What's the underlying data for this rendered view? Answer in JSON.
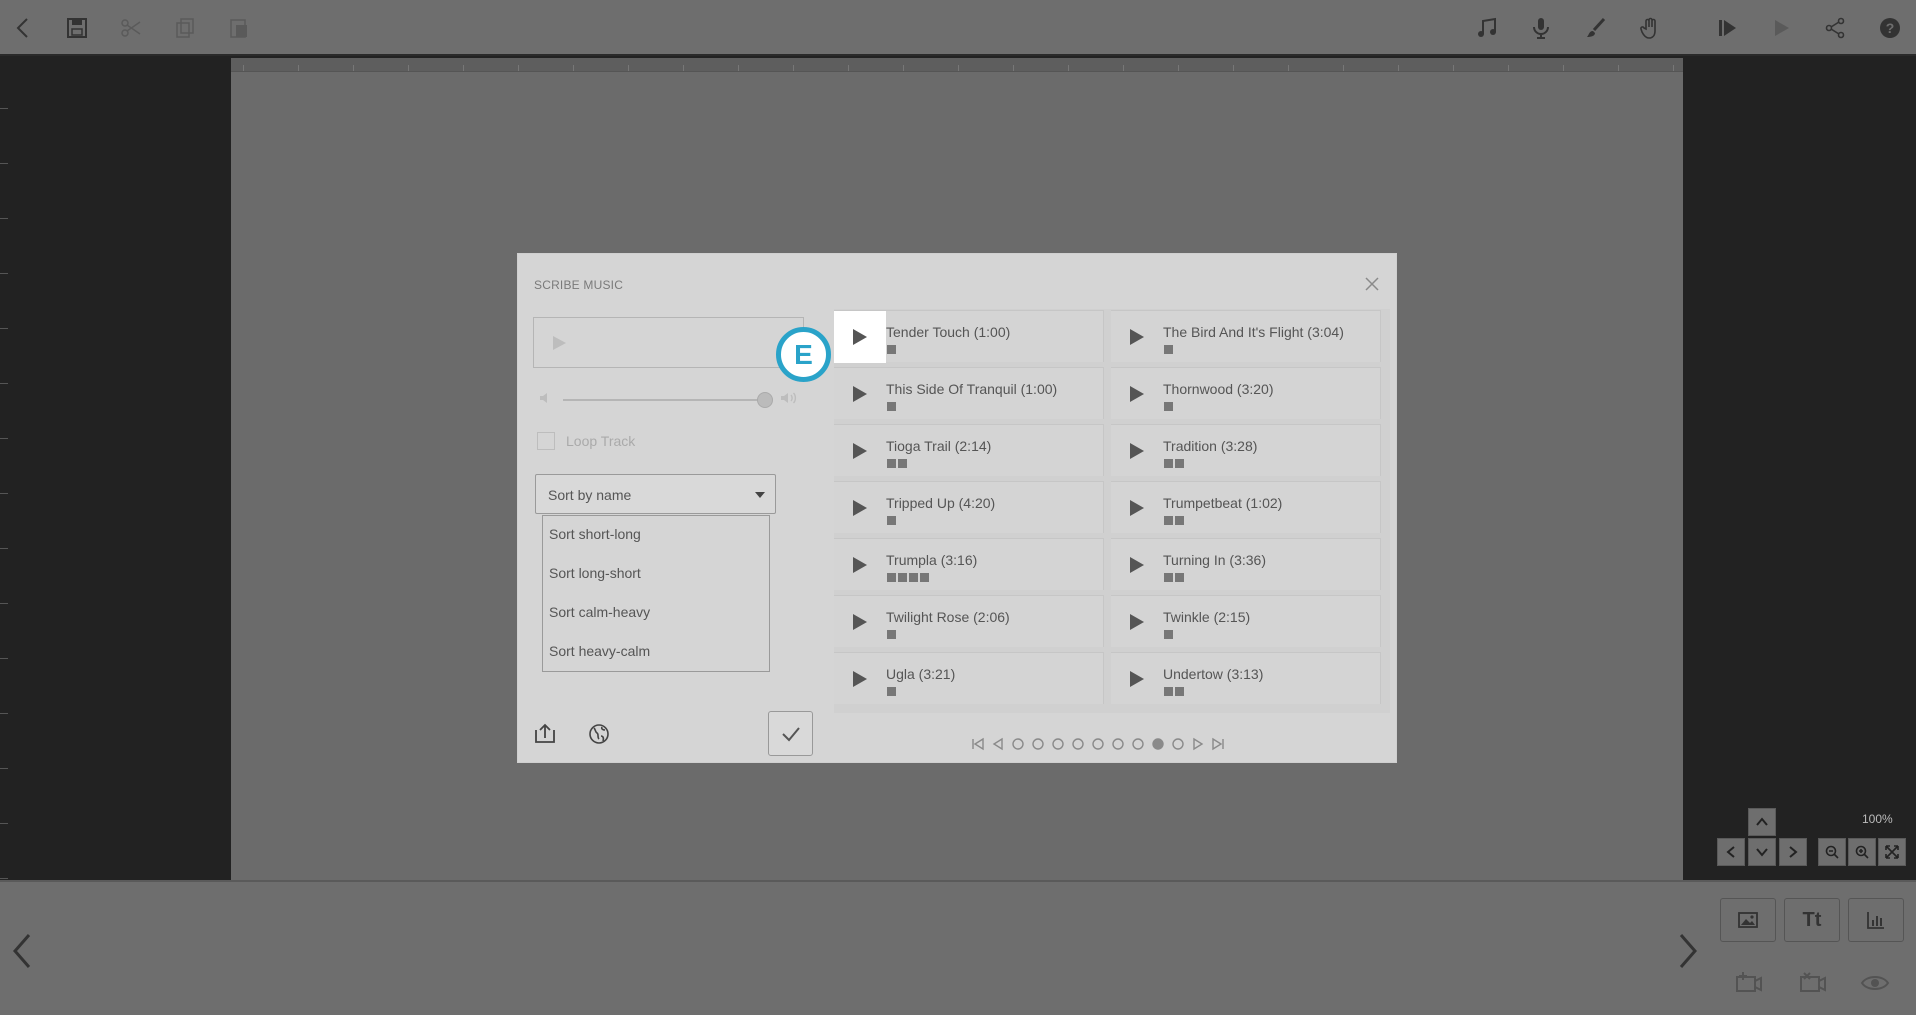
{
  "zoom_label": "100%",
  "toolbar": {
    "left_icons": [
      "back-icon",
      "save-icon",
      "cut-icon",
      "copy-icon",
      "paste-icon"
    ],
    "right_icons": [
      "music-icon",
      "microphone-icon",
      "brush-icon",
      "hand-icon",
      "play-from-icon",
      "play-icon",
      "share-icon",
      "help-icon"
    ]
  },
  "bottom": {
    "text_button_label": "Tt"
  },
  "dialog": {
    "title": "SCRIBE MUSIC",
    "loop_label": "Loop Track",
    "sort": {
      "selected": "Sort by name",
      "options": [
        "Sort short-long",
        "Sort long-short",
        "Sort calm-heavy",
        "Sort heavy-calm"
      ]
    },
    "tracks": [
      {
        "name": "Tender Touch (1:00)",
        "intensity": 1
      },
      {
        "name": "The Bird And It's Flight (3:04)",
        "intensity": 1
      },
      {
        "name": "This Side Of Tranquil (1:00)",
        "intensity": 1
      },
      {
        "name": "Thornwood (3:20)",
        "intensity": 1
      },
      {
        "name": "Tioga Trail (2:14)",
        "intensity": 2
      },
      {
        "name": "Tradition (3:28)",
        "intensity": 2
      },
      {
        "name": "Tripped Up (4:20)",
        "intensity": 1
      },
      {
        "name": "Trumpetbeat (1:02)",
        "intensity": 2
      },
      {
        "name": "Trumpla (3:16)",
        "intensity": 4
      },
      {
        "name": "Turning In (3:36)",
        "intensity": 2
      },
      {
        "name": "Twilight Rose (2:06)",
        "intensity": 1
      },
      {
        "name": "Twinkle (2:15)",
        "intensity": 1
      },
      {
        "name": "Ugla (3:21)",
        "intensity": 1
      },
      {
        "name": "Undertow (3:13)",
        "intensity": 2
      }
    ],
    "pager": {
      "pages": 9,
      "current": 8
    }
  },
  "step_badge": "E",
  "colors": {
    "accent": "#2aa3c9"
  }
}
